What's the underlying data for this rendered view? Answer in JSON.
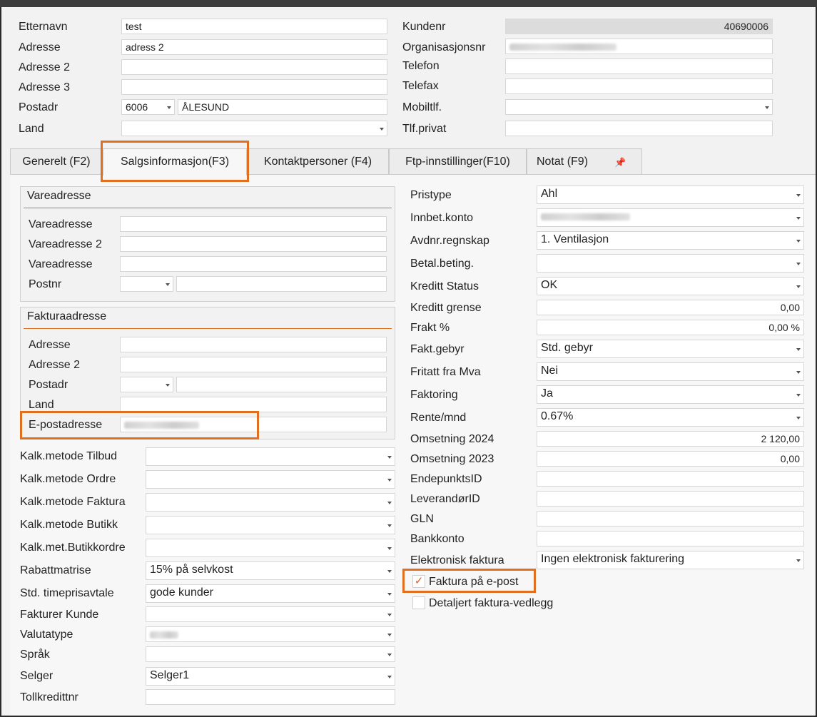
{
  "header": {
    "etternavn": {
      "label": "Etternavn",
      "value": "test"
    },
    "adresse": {
      "label": "Adresse",
      "value": "adress 2"
    },
    "adresse2": {
      "label": "Adresse 2",
      "value": ""
    },
    "adresse3": {
      "label": "Adresse 3",
      "value": ""
    },
    "postadr": {
      "label": "Postadr",
      "postnr": "6006",
      "sted": "ÅLESUND"
    },
    "land": {
      "label": "Land",
      "value": ""
    },
    "kundenr": {
      "label": "Kundenr",
      "value": "40690006"
    },
    "organisasjonsnr": {
      "label": "Organisasjonsnr"
    },
    "telefon": {
      "label": "Telefon",
      "value": ""
    },
    "telefax": {
      "label": "Telefax",
      "value": ""
    },
    "mobiltlf": {
      "label": "Mobiltlf.",
      "value": ""
    },
    "tlfprivat": {
      "label": "Tlf.privat",
      "value": ""
    }
  },
  "tabs": [
    {
      "label": "Generelt (F2)"
    },
    {
      "label": "Salgsinformasjon(F3)"
    },
    {
      "label": "Kontaktpersoner (F4)"
    },
    {
      "label": "Ftp-innstillinger(F10)"
    },
    {
      "label": "Notat (F9)"
    }
  ],
  "vareadresse": {
    "title": "Vareadresse",
    "vareadresse": {
      "label": "Vareadresse",
      "value": ""
    },
    "vareadresse2": {
      "label": "Vareadresse 2",
      "value": ""
    },
    "vareadresse3": {
      "label": "Vareadresse",
      "value": ""
    },
    "postnr": {
      "label": "Postnr",
      "value": ""
    }
  },
  "fakturaadresse": {
    "title": "Fakturaadresse",
    "adresse": {
      "label": "Adresse",
      "value": ""
    },
    "adresse2": {
      "label": "Adresse 2",
      "value": ""
    },
    "postadr": {
      "label": "Postadr",
      "value": ""
    },
    "land": {
      "label": "Land",
      "value": ""
    },
    "epost": {
      "label": "E-postadresse"
    }
  },
  "left_fields": {
    "kalk_tilbud": {
      "label": "Kalk.metode Tilbud",
      "value": ""
    },
    "kalk_ordre": {
      "label": "Kalk.metode Ordre",
      "value": ""
    },
    "kalk_faktura": {
      "label": "Kalk.metode Faktura",
      "value": ""
    },
    "kalk_butikk": {
      "label": "Kalk.metode Butikk",
      "value": ""
    },
    "kalk_butikkordre": {
      "label": "Kalk.met.Butikkordre",
      "value": ""
    },
    "rabattmatrise": {
      "label": "Rabattmatrise",
      "value": "15% på selvkost"
    },
    "timepris": {
      "label": "Std. timeprisavtale",
      "value": "gode kunder"
    },
    "fakturer_kunde": {
      "label": "Fakturer Kunde",
      "value": ""
    },
    "valutatype": {
      "label": "Valutatype"
    },
    "sprak": {
      "label": "Språk",
      "value": ""
    },
    "selger": {
      "label": "Selger",
      "value": "Selger1"
    },
    "tollkredittnr": {
      "label": "Tollkredittnr",
      "value": ""
    }
  },
  "right_fields": {
    "pristype": {
      "label": "Pristype",
      "value": "Ahl"
    },
    "innbet_konto": {
      "label": "Innbet.konto"
    },
    "avdnr": {
      "label": "Avdnr.regnskap",
      "value": "1.  Ventilasjon"
    },
    "betal": {
      "label": "Betal.beting.",
      "value": ""
    },
    "kreditt_status": {
      "label": "Kreditt Status",
      "value": "OK"
    },
    "kreditt_grense": {
      "label": "Kreditt grense",
      "value": "0,00"
    },
    "frakt": {
      "label": "Frakt %",
      "value": "0,00 %"
    },
    "fakt_gebyr": {
      "label": "Fakt.gebyr",
      "value": "Std. gebyr"
    },
    "fritatt_mva": {
      "label": "Fritatt fra Mva",
      "value": "Nei"
    },
    "faktoring": {
      "label": "Faktoring",
      "value": "Ja"
    },
    "rente": {
      "label": "Rente/mnd",
      "value": " 0.67%"
    },
    "oms2024": {
      "label": "Omsetning 2024",
      "value": "2 120,00"
    },
    "oms2023": {
      "label": "Omsetning 2023",
      "value": "0,00"
    },
    "endepunkt": {
      "label": "EndepunktsID",
      "value": ""
    },
    "leverandor": {
      "label": "LeverandørID",
      "value": ""
    },
    "gln": {
      "label": "GLN",
      "value": ""
    },
    "bankkonto": {
      "label": "Bankkonto",
      "value": ""
    },
    "elektronisk": {
      "label": "Elektronisk faktura",
      "value": "Ingen elektronisk fakturering"
    }
  },
  "checkboxes": {
    "faktura_epost": {
      "label": "Faktura på e-post",
      "checked": true,
      "mark": "✓"
    },
    "detaljert": {
      "label": "Detaljert faktura-vedlegg",
      "checked": false
    }
  },
  "colors": {
    "highlight": "#e07020",
    "check": "#e05a1e"
  }
}
